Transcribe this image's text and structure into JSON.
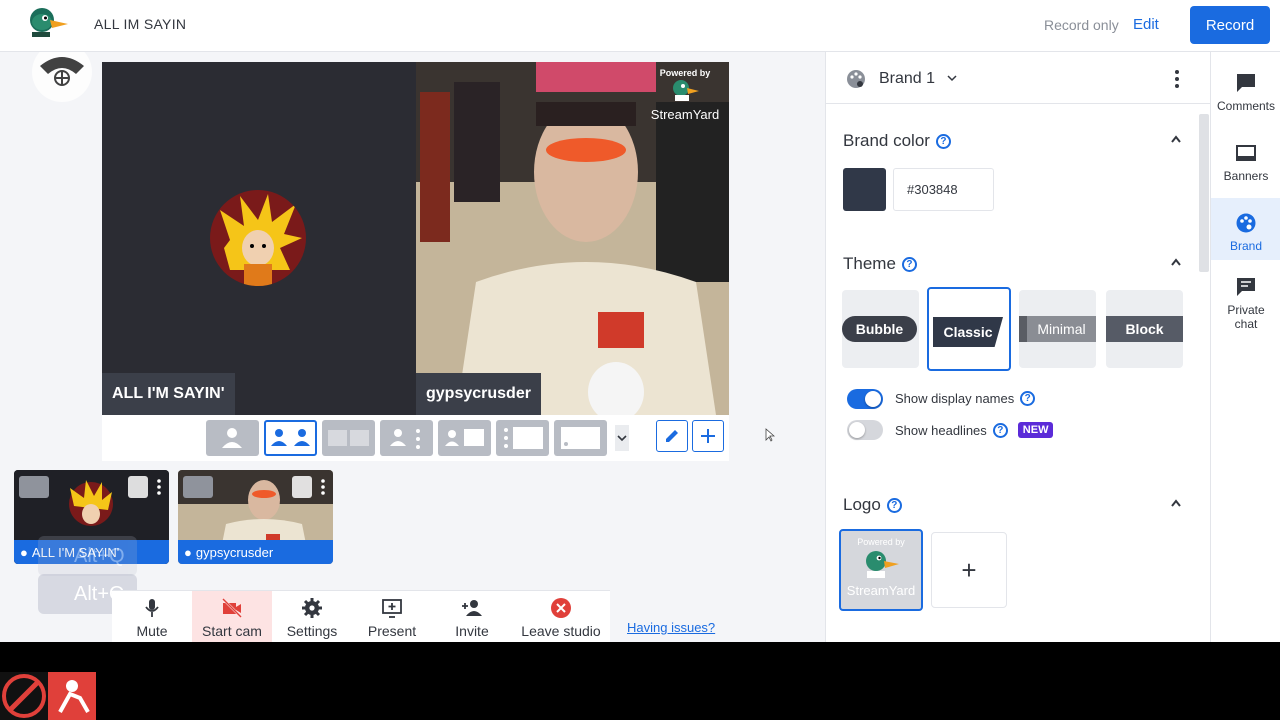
{
  "header": {
    "title": "ALL IM SAYIN",
    "record_only": "Record only",
    "edit": "Edit",
    "record": "Record"
  },
  "stage": {
    "left_name": "ALL I'M SAYIN'",
    "right_name": "gypsycrusder",
    "watermark_powered_by": "Powered by",
    "watermark_brand": "StreamYard"
  },
  "thumbnails": [
    {
      "name": "ALL I'M SAYIN'"
    },
    {
      "name": "gypsycrusder"
    }
  ],
  "shortcut_hint": "Alt+Q",
  "controls": {
    "mute": "Mute",
    "start_cam": "Start cam",
    "settings": "Settings",
    "present": "Present",
    "invite": "Invite",
    "leave": "Leave studio",
    "having_issues": "Having issues?"
  },
  "brand_panel": {
    "brand_name": "Brand 1",
    "brand_color_title": "Brand color",
    "brand_color_value": "#303848",
    "theme_title": "Theme",
    "themes": [
      "Bubble",
      "Classic",
      "Minimal",
      "Block"
    ],
    "selected_theme": "Classic",
    "show_display_names": "Show display names",
    "show_display_names_on": true,
    "show_headlines": "Show headlines",
    "show_headlines_on": false,
    "new_badge": "NEW",
    "logo_title": "Logo",
    "logo_powered_by": "Powered by",
    "logo_brand": "StreamYard",
    "add_logo": "+"
  },
  "side_nav": {
    "comments": "Comments",
    "banners": "Banners",
    "brand": "Brand",
    "private_chat": "Private chat"
  },
  "colors": {
    "accent": "#1a6be0",
    "brand_color": "#303848",
    "danger_bg": "#fde3e3",
    "new_badge": "#5b2bd8"
  }
}
